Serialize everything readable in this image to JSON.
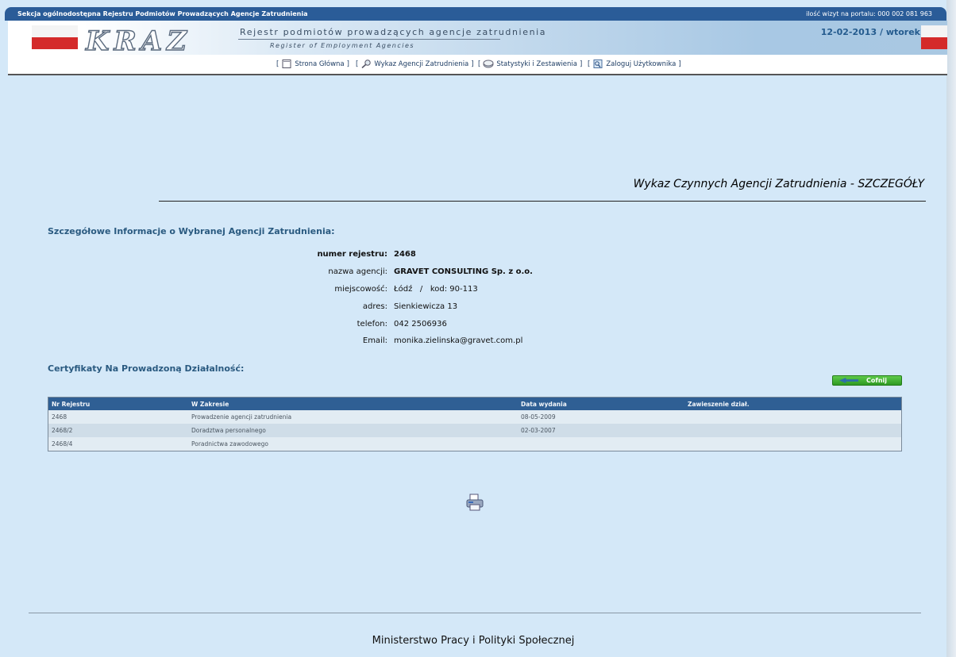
{
  "topbar": {
    "left": "Sekcja ogólnodostępna Rejestru Podmiotów Prowadzących Agencje Zatrudnienia",
    "right": "ilość wizyt na portalu: 000 002 081 963"
  },
  "header": {
    "logo": "KRAZ",
    "subtitle_pl": "Rejestr podmiotów prowadzących agencje zatrudnienia",
    "subtitle_en": "Register of Employment Agencies",
    "date": "12-02-2013",
    "day": "wtorek"
  },
  "nav": [
    {
      "label": "Strona Główna",
      "icon": "page-icon"
    },
    {
      "label": "Wykaz Agencji Zatrudnienia",
      "icon": "magnifier-icon"
    },
    {
      "label": "Statystyki i Zestawienia",
      "icon": "disk-icon"
    },
    {
      "label": "Zaloguj Użytkownika",
      "icon": "login-icon"
    }
  ],
  "page_title": "Wykaz Czynnych Agencji Zatrudnienia - SZCZEGÓŁY",
  "details_heading": "Szczegółowe Informacje o Wybranej Agencji Zatrudnienia:",
  "details": {
    "registry_label": "numer rejestru:",
    "registry": "2468",
    "name_label": "nazwa agencji:",
    "name": "GRAVET CONSULTING Sp. z o.o.",
    "city_label": "miejscowość:",
    "city": "Łódź",
    "code_sep": "/",
    "code_label": "kod:",
    "code": "90-113",
    "address_label": "adres:",
    "address": "Sienkiewicza 13",
    "phone_label": "telefon:",
    "phone": "042 2506936",
    "email_label": "Email:",
    "email": "monika.zielinska@gravet.com.pl"
  },
  "certs_heading": "Certyfikaty Na Prowadzoną Działalność:",
  "back_button": "Cofnij",
  "table": {
    "headers": [
      "Nr Rejestru",
      "W Zakresie",
      "Data wydania",
      "Zawieszenie dział."
    ],
    "rows": [
      [
        "2468",
        "Prowadzenie agencji zatrudnienia",
        "08-05-2009",
        ""
      ],
      [
        "2468/2",
        "Doradztwa personalnego",
        "02-03-2007",
        ""
      ],
      [
        "2468/4",
        "Poradnictwa zawodowego",
        "",
        ""
      ]
    ]
  },
  "footer": "Ministerstwo Pracy i Polityki Społecznej",
  "colors": {
    "topbar": "#2a5c98",
    "background": "#d4e8f8",
    "accent": "#2a5a80",
    "button": "#3fae2f"
  }
}
